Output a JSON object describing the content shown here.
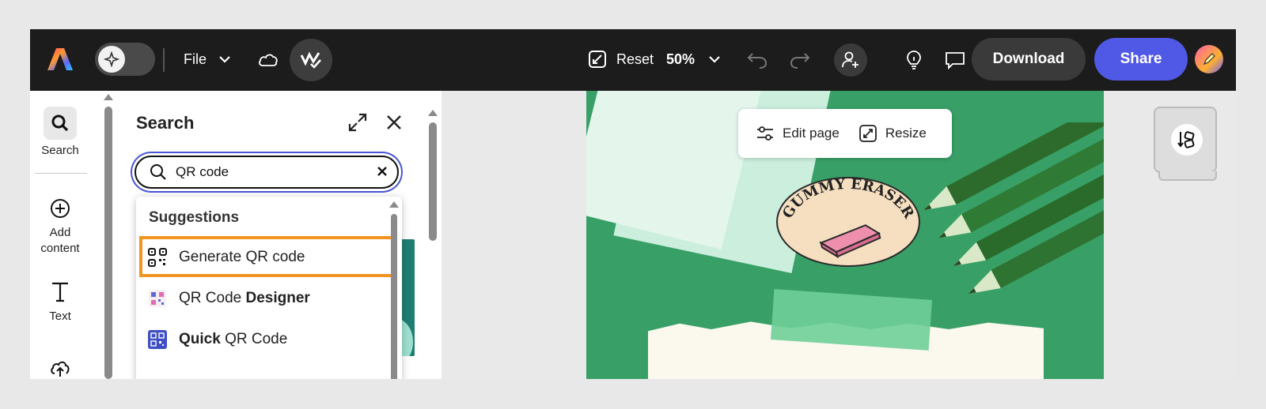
{
  "topbar": {
    "file_label": "File",
    "reset_label": "Reset",
    "zoom_label": "50%",
    "download_label": "Download",
    "share_label": "Share",
    "colors": {
      "bar": "#1c1c1c",
      "share": "#5058e6",
      "download": "#3a3a3a"
    }
  },
  "rail": {
    "items": [
      {
        "label": "Search",
        "icon": "search-icon"
      },
      {
        "label": "Add content",
        "icon": "plus-circle-icon"
      },
      {
        "label": "Text",
        "icon": "text-icon"
      }
    ]
  },
  "search_panel": {
    "title": "Search",
    "query": "QR code",
    "suggestions_title": "Suggestions",
    "suggestions": [
      {
        "plain": "Generate QR code",
        "bold": "",
        "icon": "qr-code-icon",
        "highlighted": true
      },
      {
        "plain": "QR Code ",
        "bold": "Designer",
        "icon": "qr-designer-app-icon"
      },
      {
        "bold": "Quick",
        "plain": " QR Code",
        "icon": "quick-qr-app-icon"
      }
    ]
  },
  "canvas": {
    "toolbar": {
      "edit_label": "Edit page",
      "resize_label": "Resize"
    },
    "background": "#38a066",
    "badge_text": "GUMMY ERASER"
  }
}
